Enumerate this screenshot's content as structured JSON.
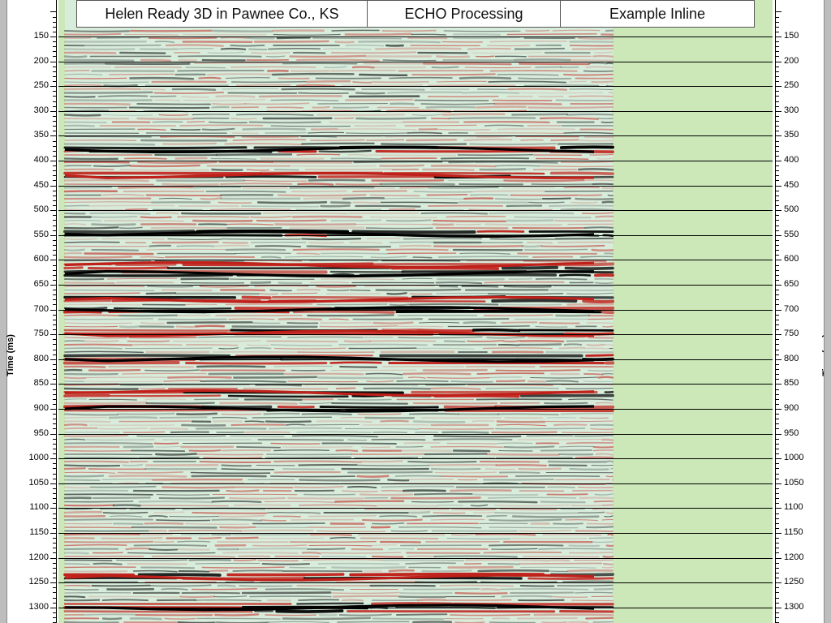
{
  "header": {
    "survey": "Helen Ready 3D in Pawnee Co., KS",
    "processing": "ECHO Processing",
    "section": "Example Inline"
  },
  "axis": {
    "title": "Time (ms)",
    "ticks": [
      "150",
      "200",
      "250",
      "300",
      "350",
      "400",
      "450",
      "500",
      "550",
      "600",
      "650",
      "700",
      "750",
      "800",
      "850",
      "900",
      "950",
      "1000",
      "1050",
      "1100",
      "1150",
      "1200",
      "1250",
      "1300"
    ]
  },
  "colors": {
    "background_fill": "#cce8b8",
    "positive_amplitude": "#000000",
    "negative_amplitude": "#c0201a",
    "wash": "#d8ecdc"
  },
  "seismic": {
    "time_range_ms": [
      100,
      1335
    ],
    "horizons_ms": [
      378,
      430,
      548,
      610,
      628,
      680,
      700,
      748,
      800,
      868,
      900,
      1240,
      1300
    ]
  }
}
